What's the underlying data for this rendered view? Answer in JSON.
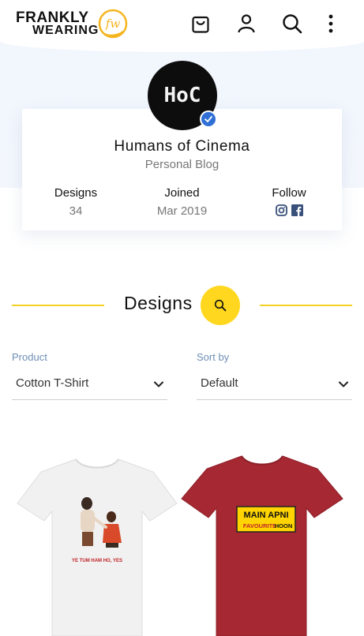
{
  "brand": {
    "line1": "FRANKLY",
    "line2": "WEARING",
    "mark": "fw",
    "accent": "#f5b51f"
  },
  "header": {
    "icons": [
      "bag-icon",
      "user-icon",
      "search-icon",
      "more-vertical-icon"
    ]
  },
  "profile": {
    "avatar_text": "HoC",
    "name": "Humans of Cinema",
    "type": "Personal Blog",
    "stats": {
      "designs_label": "Designs",
      "designs_value": "34",
      "joined_label": "Joined",
      "joined_value": "Mar 2019",
      "follow_label": "Follow"
    },
    "social": [
      "instagram-icon",
      "facebook-icon"
    ]
  },
  "section": {
    "title": "Designs",
    "accent": "#ffd71f"
  },
  "filters": {
    "product_label": "Product",
    "product_value": "Cotton T-Shirt",
    "sort_label": "Sort by",
    "sort_value": "Default"
  },
  "products": [
    {
      "color": "#f1f1f1",
      "print_text": "YE TUM HAM HO, YES"
    },
    {
      "color": "#a52832",
      "print_line1": "MAIN APNI",
      "print_line2a": "FAVOURITE",
      "print_line2b": "HOON"
    }
  ]
}
